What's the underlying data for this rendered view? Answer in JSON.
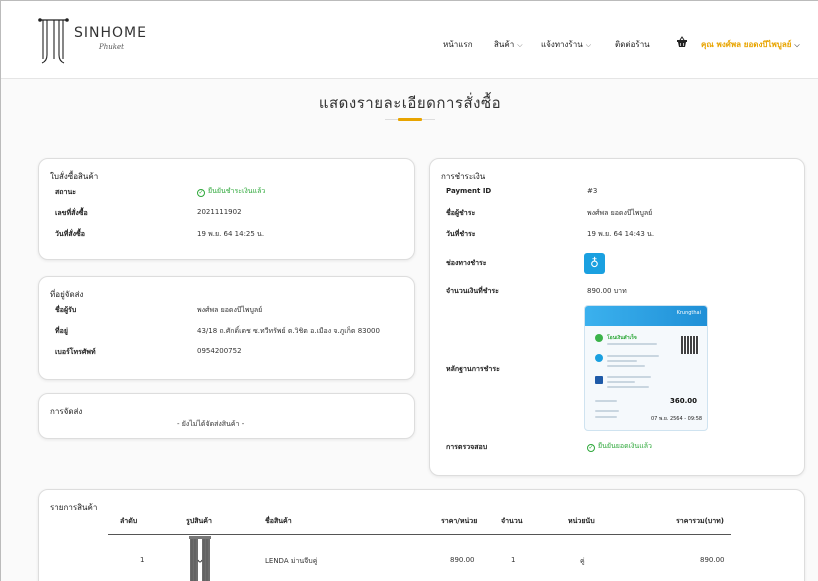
{
  "header": {
    "brand_line1": "SINHOME",
    "brand_line2": "Phuket",
    "nav": {
      "home": "หน้าแรก",
      "products": "สินค้า",
      "notify": "แจ้งทางร้าน",
      "contact": "ติดต่อร้าน",
      "user": "คุณ พงศ์พล ยอดงบึไพบูลย์"
    },
    "chevron": "⌵",
    "cart_icon": "basket-icon"
  },
  "page": {
    "title": "แสดงรายละเอียดการสั่งซื้อ"
  },
  "order": {
    "title": "ใบสั่งซื้อสินค้า",
    "status_label": "สถานะ",
    "status_value": "ยืนยันชำระเงินแล้ว",
    "number_label": "เลขที่สั่งซื้อ",
    "number_value": "2021111902",
    "date_label": "วันที่สั่งซื้อ",
    "date_value": "19 พ.ย. 64 14:25 น."
  },
  "shipping_address": {
    "title": "ที่อยู่จัดส่ง",
    "receiver_label": "ชื่อผู้รับ",
    "receiver_value": "พงศ์พล ยอดงบึไพบูลย์",
    "address_label": "ที่อยู่",
    "address_value": "43/18 ถ.ศักดิ์เดช ซ.ทวีทรัพย์ ต.วิชิต อ.เมือง จ.ภูเก็ต 83000",
    "phone_label": "เบอร์โทรศัพท์",
    "phone_value": "0954200752"
  },
  "delivery": {
    "title": "การจัดส่ง",
    "status": "- ยังไม่ได้จัดส่งสินค้า -"
  },
  "payment": {
    "title": "การชำระเงิน",
    "id_label": "Payment ID",
    "id_value": "#3",
    "payer_label": "ชื่อผู้ชำระ",
    "payer_value": "พงศ์พล ยอดงบึไพบูลย์",
    "date_label": "วันที่ชำระ",
    "date_value": "19 พ.ย. 64 14:43 น.",
    "channel_label": "ช่องทางชำระ",
    "channel_icon": "krungthai-bank-icon",
    "amount_label": "จำนวนเงินที่ชำระ",
    "amount_value": "890.00 บาท",
    "proof_label": "หลักฐานการชำระ",
    "verify_label": "การตรวจสอบ",
    "verify_value": "ยืนยันยอดเงินแล้ว",
    "slip": {
      "bank_name": "Krungthai",
      "status": "โอนเงินสำเร็จ",
      "amount": "360.00",
      "date": "07 พ.ย. 2564 - 09:58"
    }
  },
  "items": {
    "title": "รายการสินค้า",
    "columns": [
      "ลำดับ",
      "รูปสินค้า",
      "ชื่อสินค้า",
      "ราคา/หน่วย",
      "จำนวน",
      "หน่วยนับ",
      "ราคารวม(บาท)"
    ],
    "rows": [
      {
        "no": "1",
        "image_icon": "curtain-product-image",
        "name": "LENDA ม่านจีบคู่",
        "unit_price": "890.00",
        "qty": "1",
        "unit": "คู่",
        "total": "890.00"
      }
    ]
  },
  "colors": {
    "accent": "#e8a400",
    "success": "#2ea83a",
    "bank_blue": "#1aa0e0"
  }
}
